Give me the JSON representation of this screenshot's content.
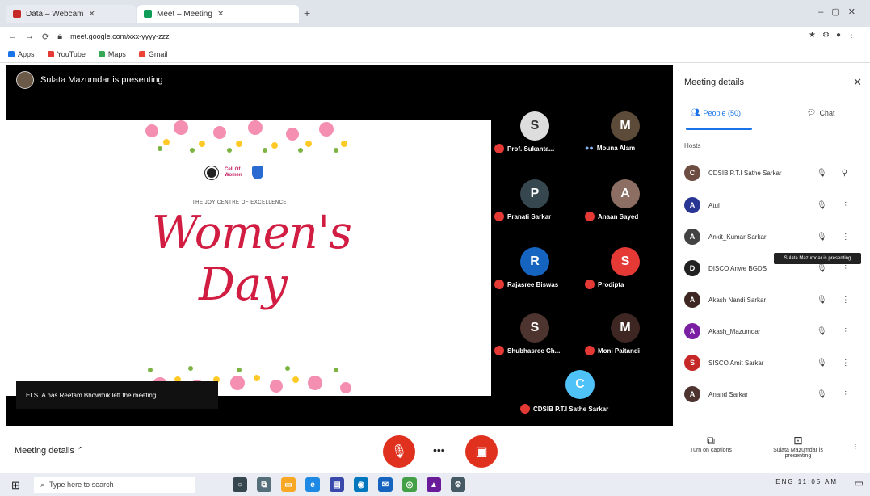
{
  "browser": {
    "tabs": [
      {
        "title": "Data – Webcam",
        "fav_color": "#c62828"
      },
      {
        "title": "Meet – Meeting",
        "fav_color": "#0f9d58"
      }
    ],
    "url": "meet.google.com/xxx-yyyy-zzz",
    "bookmarks": [
      {
        "label": "Apps",
        "fav_color": "#1a73e8"
      },
      {
        "label": "YouTube",
        "fav_color": "#e53935"
      },
      {
        "label": "Maps",
        "fav_color": "#34a853"
      },
      {
        "label": "Gmail",
        "fav_color": "#ea4335"
      }
    ]
  },
  "meet": {
    "presenting_text": "Sulata Mazumdar is presenting",
    "slide": {
      "logo_text": "Cell Of Women",
      "small_caption": "THE JOY CENTRE OF EXCELLENCE",
      "title_line1": "Women's",
      "title_line2": "Day"
    },
    "left_notice": "ELSTA has Reetam Bhowmik left the meeting",
    "participants": [
      {
        "name": "Prof. Sukanta...",
        "initial": "S",
        "color": "#ddd",
        "muted": true
      },
      {
        "name": "Mouna Alam",
        "initial": "M",
        "color": "#5d4b3a",
        "muted": false
      },
      {
        "name": "Pranati Sarkar",
        "initial": "P",
        "color": "#37474f",
        "muted": true
      },
      {
        "name": "Anaan Sayed",
        "initial": "A",
        "color": "#8d6e63",
        "muted": true
      },
      {
        "name": "Rajasree Biswas",
        "initial": "R",
        "color": "#1565c0",
        "muted": true
      },
      {
        "name": "Prodipta",
        "initial": "S",
        "color": "#e53935",
        "muted": true
      },
      {
        "name": "Shubhasree Ch...",
        "initial": "S",
        "color": "#4e342e",
        "muted": true
      },
      {
        "name": "Moni Paitandi",
        "initial": "M",
        "color": "#3e2723",
        "muted": true
      },
      {
        "name": "CDSIB P.T.I Sathe Sarkar",
        "initial": "C",
        "color": "#4fc3f7",
        "muted": true
      }
    ]
  },
  "toolbar": {
    "meeting_details": "Meeting details",
    "mic_icon": "mic-off-icon",
    "more_icon": "more-icon",
    "camera_icon": "camera-off-icon",
    "captions_label": "Turn on captions",
    "present_label": "Sulata Mazumdar is presenting"
  },
  "panel": {
    "title": "Meeting details",
    "tab_people": "People (50)",
    "tab_chat": "Chat",
    "section_label": "Hosts",
    "tooltip": "Sulata Mazumdar is presenting",
    "rows": [
      {
        "name": "CDSIB P.T.I Sathe Sarkar",
        "initial": "C",
        "color": "#6d4c41"
      },
      {
        "name": "Atul",
        "initial": "A",
        "color": "#283593"
      },
      {
        "name": "Ankit_Kumar Sarkar",
        "initial": "A",
        "color": "#424242"
      },
      {
        "name": "DISCO Anwe BGDS",
        "initial": "D",
        "color": "#212121"
      },
      {
        "name": "Akash Nandi Sarkar",
        "initial": "A",
        "color": "#3e2723"
      },
      {
        "name": "Akash_Mazumdar",
        "initial": "A",
        "color": "#7b1fa2"
      },
      {
        "name": "SISCO Amit Sarkar",
        "initial": "S",
        "color": "#c62828"
      },
      {
        "name": "Anand Sarkar",
        "initial": "A",
        "color": "#4e342e"
      }
    ]
  },
  "taskbar": {
    "search_placeholder": "Type here to search",
    "tray_text": "ENG 11:05 AM",
    "apps": [
      {
        "icon": "cortana-icon",
        "color": "#37474f"
      },
      {
        "icon": "task-view-icon",
        "color": "#546e7a"
      },
      {
        "icon": "file-explorer-icon",
        "color": "#f9a825"
      },
      {
        "icon": "edge-icon",
        "color": "#1e88e5"
      },
      {
        "icon": "store-icon",
        "color": "#3949ab"
      },
      {
        "icon": "maps-icon",
        "color": "#0277bd"
      },
      {
        "icon": "mail-icon",
        "color": "#1565c0"
      },
      {
        "icon": "chrome-icon",
        "color": "#43a047"
      },
      {
        "icon": "photos-icon",
        "color": "#6a1b9a"
      },
      {
        "icon": "settings-icon",
        "color": "#455a64"
      }
    ]
  }
}
